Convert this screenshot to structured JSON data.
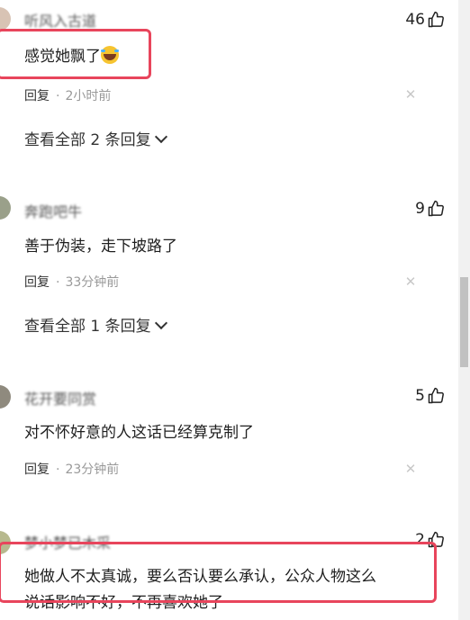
{
  "comments": [
    {
      "username": "听风入古道",
      "likes": "46",
      "text": "感觉她飘了",
      "reply_label": "回复",
      "time": "2小时前",
      "view_more": "查看全部 2 条回复"
    },
    {
      "username": "奔跑吧牛",
      "likes": "9",
      "text": "善于伪装，走下坡路了",
      "reply_label": "回复",
      "time": "33分钟前",
      "view_more": "查看全部 1 条回复"
    },
    {
      "username": "花开要同赏",
      "likes": "5",
      "text": "对不怀好意的人这话已经算克制了",
      "reply_label": "回复",
      "time": "23分钟前"
    },
    {
      "username": "梦小梦已木采",
      "likes": "2",
      "text_line1": "她做人不太真诚，要么否认要么承认，公众人物这么",
      "text_line2": "说话影响不好，不再喜欢她了"
    }
  ],
  "icons": {
    "like": "thumbs-up-icon",
    "close": "close-icon",
    "chevron": "chevron-down-icon",
    "emoji": "laughing-crying-emoji"
  },
  "colors": {
    "highlight": "#e8455c",
    "meta_gray": "#999999"
  }
}
